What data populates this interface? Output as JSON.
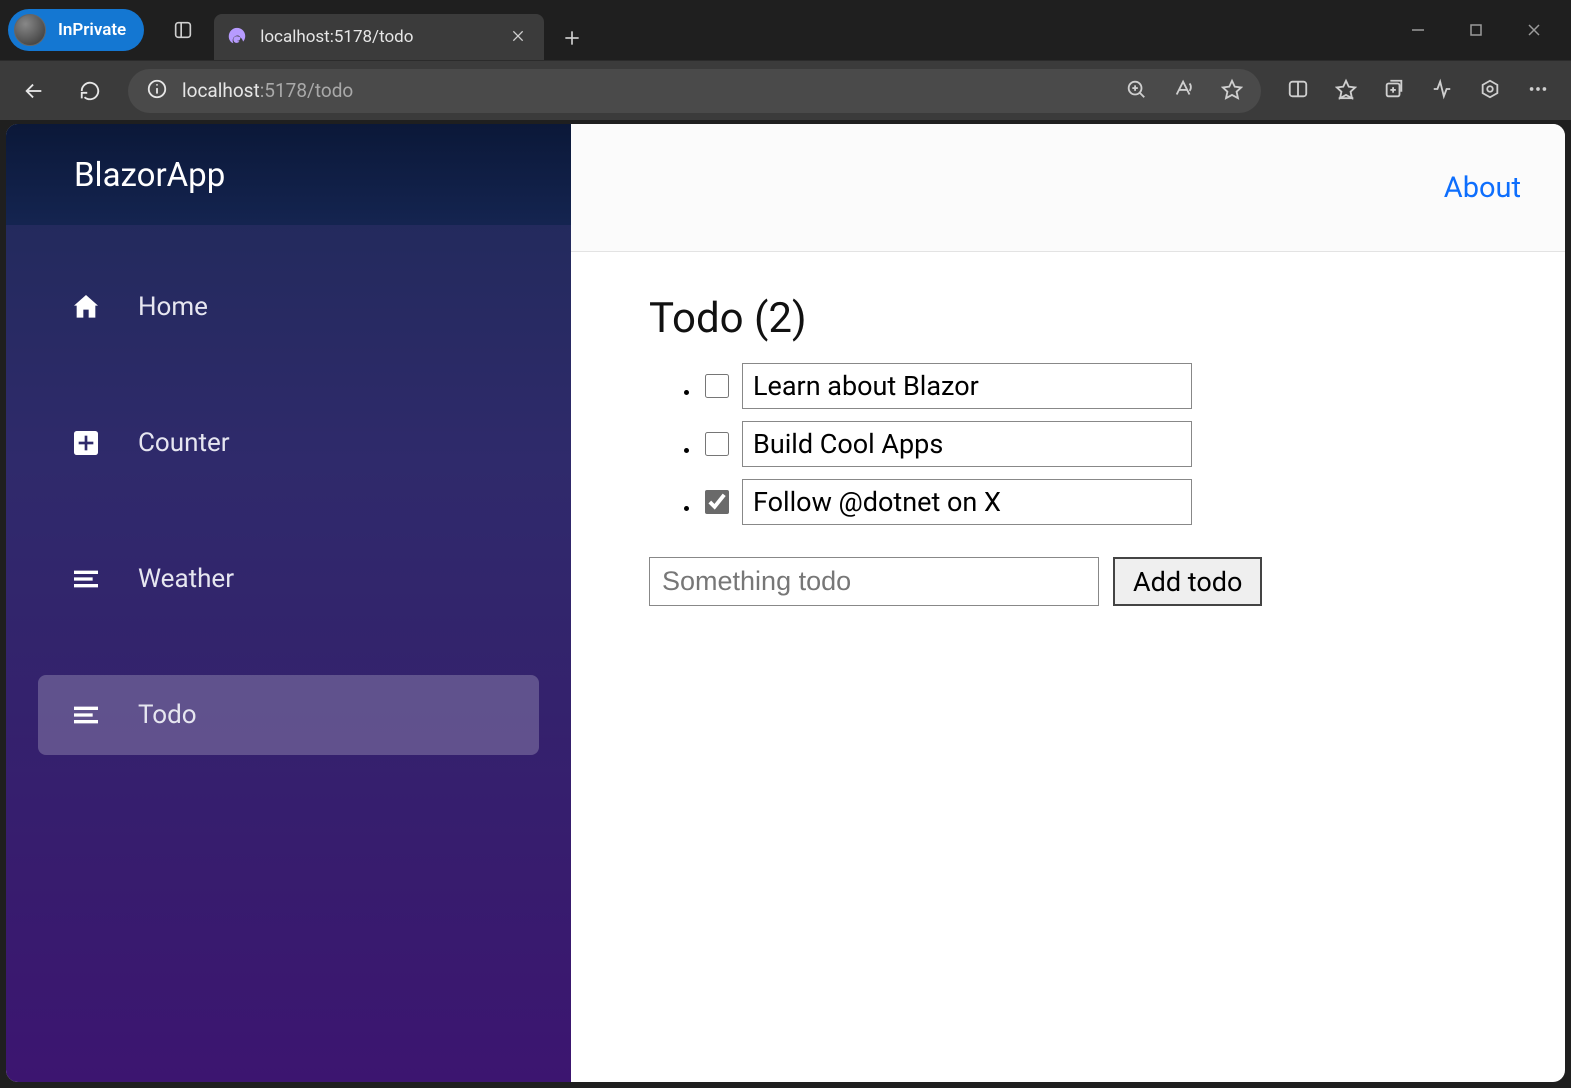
{
  "browser": {
    "inprivate_label": "InPrivate",
    "tab_title": "localhost:5178/todo",
    "url_host": "localhost",
    "url_rest": ":5178/todo"
  },
  "sidebar": {
    "brand": "BlazorApp",
    "items": [
      {
        "label": "Home"
      },
      {
        "label": "Counter"
      },
      {
        "label": "Weather"
      },
      {
        "label": "Todo"
      }
    ]
  },
  "header": {
    "about_label": "About"
  },
  "todo": {
    "heading_prefix": "Todo (",
    "heading_count": "2",
    "heading_suffix": ")",
    "items": [
      {
        "text": "Learn about Blazor",
        "done": false
      },
      {
        "text": "Build Cool Apps",
        "done": false
      },
      {
        "text": "Follow @dotnet on X",
        "done": true
      }
    ],
    "input_placeholder": "Something todo",
    "add_button": "Add todo"
  }
}
